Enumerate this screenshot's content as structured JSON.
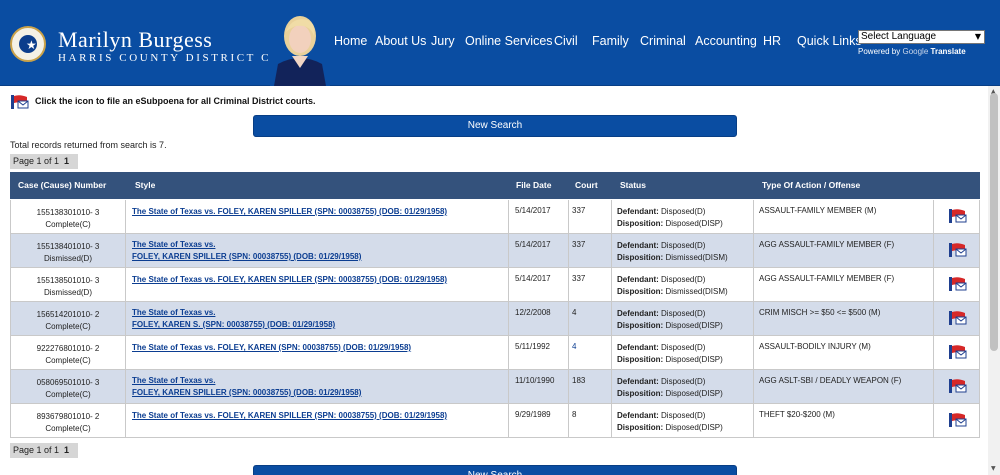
{
  "header": {
    "name": "Marilyn Burgess",
    "subtitle": "HARRIS COUNTY DISTRICT CLERK",
    "nav": [
      "Home",
      "About Us",
      "Jury",
      "Online Services",
      "Civil",
      "Family",
      "Criminal",
      "Accounting",
      "HR",
      "Quick Links"
    ],
    "language_select": "Select Language",
    "powered_by": "Powered by",
    "google": "Google",
    "translate": "Translate"
  },
  "colors": {
    "brand_blue": "#0a4da2",
    "table_header": "#34527c",
    "row_alt": "#d4dcea",
    "link": "#0b3d91"
  },
  "subpoena_text": "Click the icon to file an eSubpoena for all Criminal District courts.",
  "new_search_label": "New Search",
  "total_text": "Total records returned from search is 7.",
  "pager": {
    "text": "Page 1 of 1",
    "current": "1"
  },
  "table": {
    "headers": [
      "Case (Cause) Number",
      "Style",
      "File Date",
      "Court",
      "Status",
      "Type Of Action / Offense"
    ],
    "rows": [
      {
        "case": "155138301010- 3",
        "case_status": "Complete(C)",
        "style": [
          "The State of Texas vs. FOLEY, KAREN SPILLER (SPN: 00038755) (DOB: 01/29/1958)"
        ],
        "file_date": "5/14/2017",
        "court": "337",
        "court_link": false,
        "defendant_label": "Defendant:",
        "defendant": "Disposed(D)",
        "disposition_label": "Disposition:",
        "disposition": "Disposed(DISP)",
        "offense": "ASSAULT-FAMILY MEMBER (M)"
      },
      {
        "case": "155138401010- 3",
        "case_status": "Dismissed(D)",
        "style": [
          "The State of Texas vs.",
          "FOLEY, KAREN SPILLER (SPN: 00038755) (DOB: 01/29/1958)"
        ],
        "file_date": "5/14/2017",
        "court": "337",
        "court_link": false,
        "defendant_label": "Defendant:",
        "defendant": "Disposed(D)",
        "disposition_label": "Disposition:",
        "disposition": "Dismissed(DISM)",
        "offense": "AGG ASSAULT-FAMILY MEMBER (F)"
      },
      {
        "case": "155138501010- 3",
        "case_status": "Dismissed(D)",
        "style": [
          "The State of Texas vs. FOLEY, KAREN SPILLER (SPN: 00038755) (DOB: 01/29/1958)"
        ],
        "file_date": "5/14/2017",
        "court": "337",
        "court_link": false,
        "defendant_label": "Defendant:",
        "defendant": "Disposed(D)",
        "disposition_label": "Disposition:",
        "disposition": "Dismissed(DISM)",
        "offense": "AGG ASSAULT-FAMILY MEMBER (F)"
      },
      {
        "case": "156514201010- 2",
        "case_status": "Complete(C)",
        "style": [
          "The State of Texas vs.",
          "FOLEY, KAREN S. (SPN: 00038755) (DOB: 01/29/1958)"
        ],
        "file_date": "12/2/2008",
        "court": "4",
        "court_link": false,
        "defendant_label": "Defendant:",
        "defendant": "Disposed(D)",
        "disposition_label": "Disposition:",
        "disposition": "Disposed(DISP)",
        "offense": "CRIM MISCH >= $50 <= $500 (M)"
      },
      {
        "case": "922276801010- 2",
        "case_status": "Complete(C)",
        "style": [
          "The State of Texas vs. FOLEY, KAREN (SPN: 00038755) (DOB: 01/29/1958)"
        ],
        "file_date": "5/11/1992",
        "court": "4",
        "court_link": true,
        "defendant_label": "Defendant:",
        "defendant": "Disposed(D)",
        "disposition_label": "Disposition:",
        "disposition": "Disposed(DISP)",
        "offense": "ASSAULT-BODILY INJURY (M)"
      },
      {
        "case": "058069501010- 3",
        "case_status": "Complete(C)",
        "style": [
          "The State of Texas vs.",
          "FOLEY, KAREN SPILLER (SPN: 00038755) (DOB: 01/29/1958)"
        ],
        "file_date": "11/10/1990",
        "court": "183",
        "court_link": false,
        "defendant_label": "Defendant:",
        "defendant": "Disposed(D)",
        "disposition_label": "Disposition:",
        "disposition": "Disposed(DISP)",
        "offense": "AGG ASLT-SBI / DEADLY WEAPON (F)"
      },
      {
        "case": "893679801010- 2",
        "case_status": "Complete(C)",
        "style": [
          "The State of Texas vs. FOLEY, KAREN SPILLER (SPN: 00038755) (DOB: 01/29/1958)"
        ],
        "file_date": "9/29/1989",
        "court": "8",
        "court_link": false,
        "defendant_label": "Defendant:",
        "defendant": "Disposed(D)",
        "disposition_label": "Disposition:",
        "disposition": "Disposed(DISP)",
        "offense": "THEFT $20-$200 (M)"
      }
    ]
  }
}
